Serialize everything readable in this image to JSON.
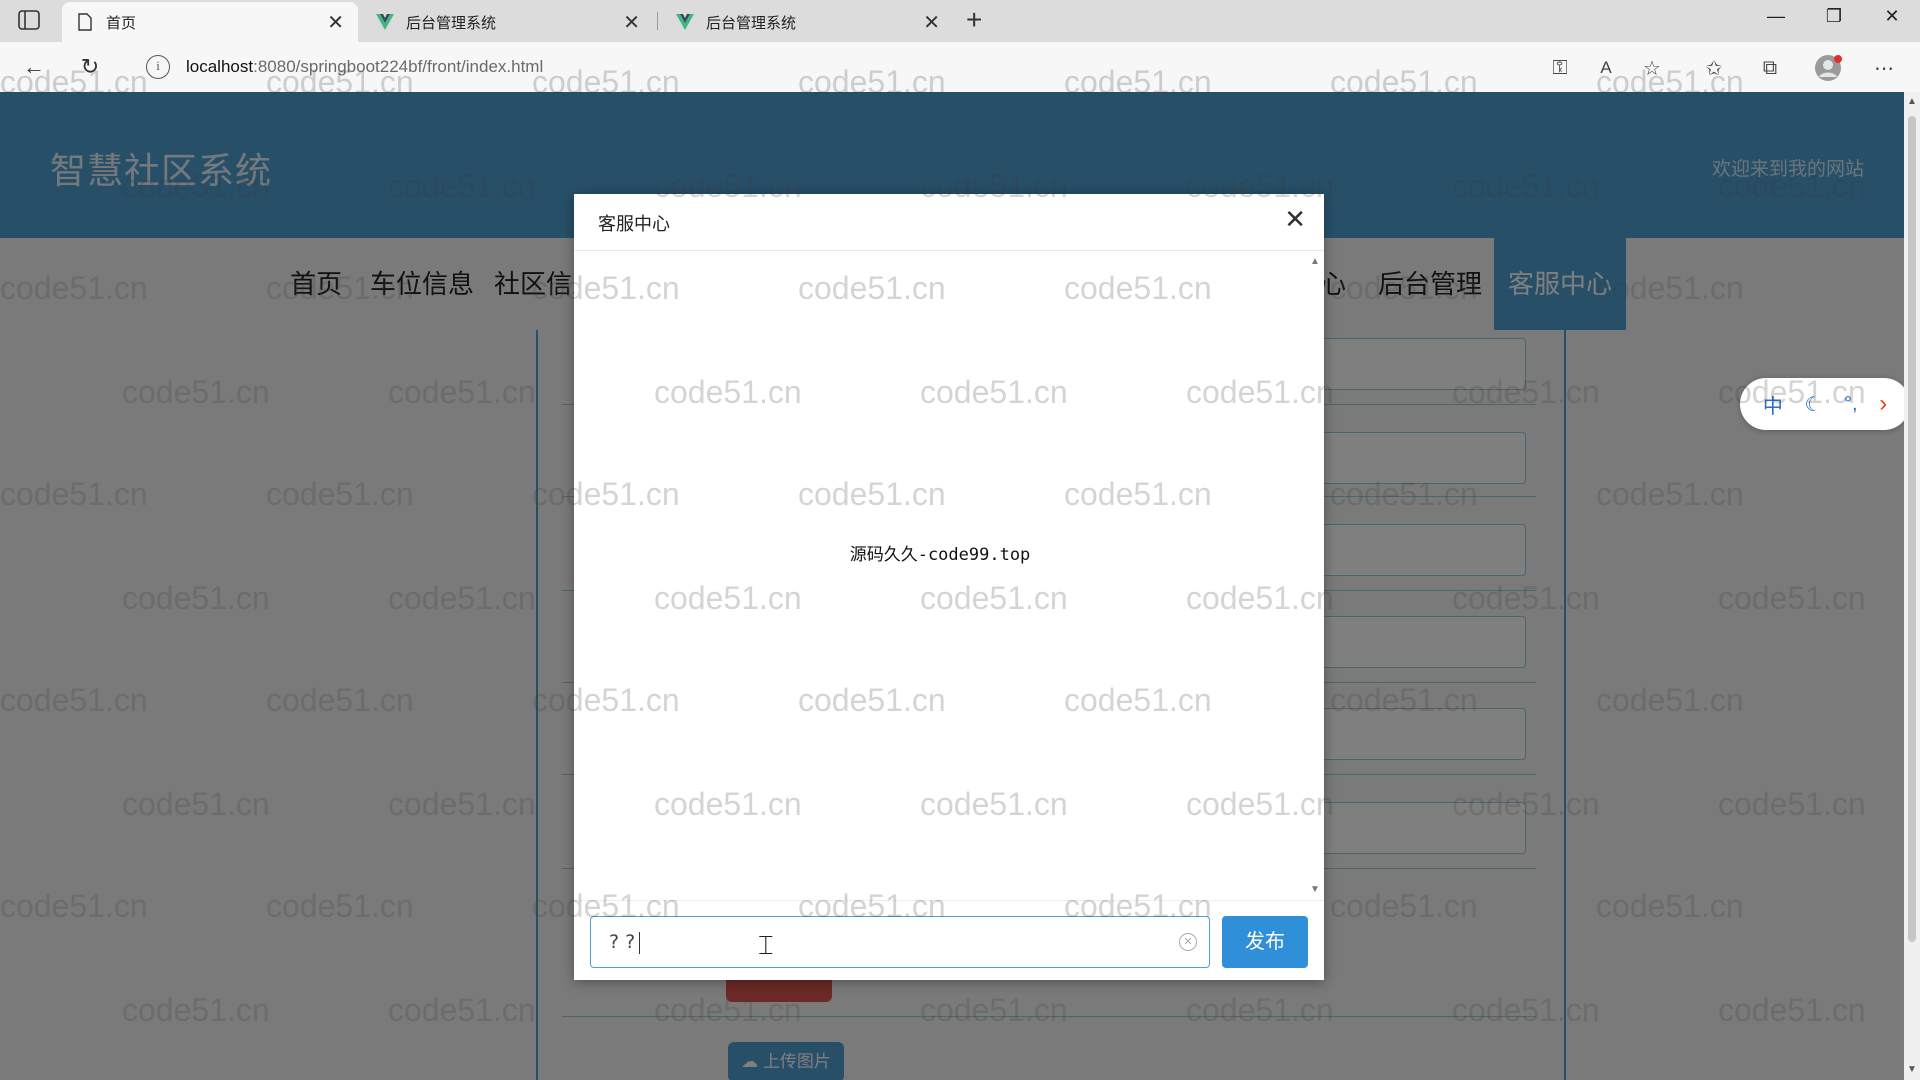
{
  "browser": {
    "tabs": [
      {
        "title": "首页",
        "icon": "page-icon",
        "active": true
      },
      {
        "title": "后台管理系统",
        "icon": "vue-logo-icon",
        "active": false
      },
      {
        "title": "后台管理系统",
        "icon": "vue-logo-icon",
        "active": false
      }
    ],
    "url_host": "localhost",
    "url_path": ":8080/springboot224bf/front/index.html"
  },
  "site": {
    "title": "智慧社区系统",
    "welcome": "欢迎来到我的网站",
    "nav": [
      "首页",
      "车位信息",
      "社区信息",
      "心",
      "后台管理",
      "客服中心"
    ],
    "upload_label": "上传图片"
  },
  "dialog": {
    "title": "客服中心",
    "message": "源码久久-code99.top",
    "input_value": "? ?",
    "publish_label": "发布"
  },
  "watermark": "code51.cn",
  "colors": {
    "accent": "#4f9fd0",
    "publish": "#2f8fd8"
  }
}
